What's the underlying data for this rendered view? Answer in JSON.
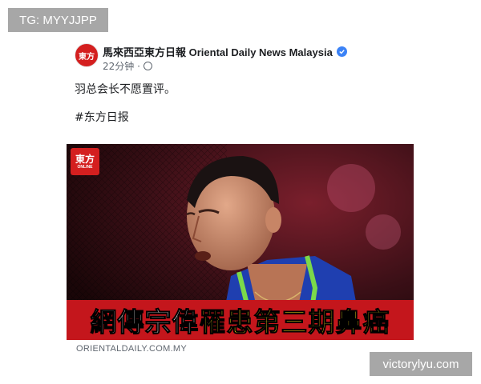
{
  "watermarks": {
    "top_left": "TG: MYYJJPP",
    "bottom_right": "victorylyu.com"
  },
  "post": {
    "page_name": "馬來西亞東方日報 Oriental Daily News Malaysia",
    "timestamp": "22分钟 ·",
    "caption": "羽总会长不愿置评。",
    "hashtag": "#东方日报",
    "avatar_text": "東方",
    "link_domain": "ORIENTALDAILY.COM.MY"
  },
  "image": {
    "logo_main": "東方",
    "logo_sub": "ONLINE",
    "headline_white": "網傳宗偉",
    "headline_yellow": "罹患第三期鼻癌"
  },
  "colors": {
    "brand_red": "#d41f1f",
    "headline_bar": "#c4161c",
    "headline_yellow": "#ffe321",
    "verified_blue": "#3b82f6",
    "watermark_gray": "#a7a7a7"
  },
  "icons": [
    "verified-badge-icon",
    "globe-icon"
  ]
}
